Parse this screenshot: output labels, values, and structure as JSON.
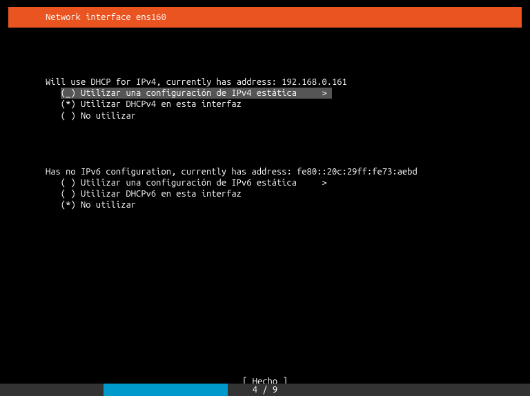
{
  "header": {
    "title": "Network interface ens160"
  },
  "ipv4": {
    "heading": "Will use DHCP for IPv4, currently has address: 192.168.0.161",
    "options": [
      {
        "marker": "(_)",
        "label": "Utilizar una configuración de IPv4 estática",
        "chevron": ">",
        "selected": true,
        "checked": false
      },
      {
        "marker": "(*)",
        "label": "Utilizar DHCPv4 en esta interfaz",
        "chevron": "",
        "selected": false,
        "checked": true
      },
      {
        "marker": "( )",
        "label": "No utilizar",
        "chevron": "",
        "selected": false,
        "checked": false
      }
    ]
  },
  "ipv6": {
    "heading": "Has no IPv6 configuration, currently has address: fe80::20c:29ff:fe73:aebd",
    "options": [
      {
        "marker": "( )",
        "label": "Utilizar una configuración de IPv6 estática",
        "chevron": ">",
        "selected": false,
        "checked": false
      },
      {
        "marker": "( )",
        "label": "Utilizar DHCPv6 en esta interfaz",
        "chevron": "",
        "selected": false,
        "checked": false
      },
      {
        "marker": "(*)",
        "label": "No utilizar",
        "chevron": "",
        "selected": false,
        "checked": true
      }
    ]
  },
  "footer": {
    "done_label": "[ Hecho      ]"
  },
  "progress": {
    "current": 4,
    "total": 9,
    "label": "4 / 9",
    "fill_percent": 44
  },
  "colors": {
    "accent": "#e95420",
    "progress_bar": "#0099cc",
    "progress_bg": "#333333",
    "selection_bg": "#555555"
  }
}
